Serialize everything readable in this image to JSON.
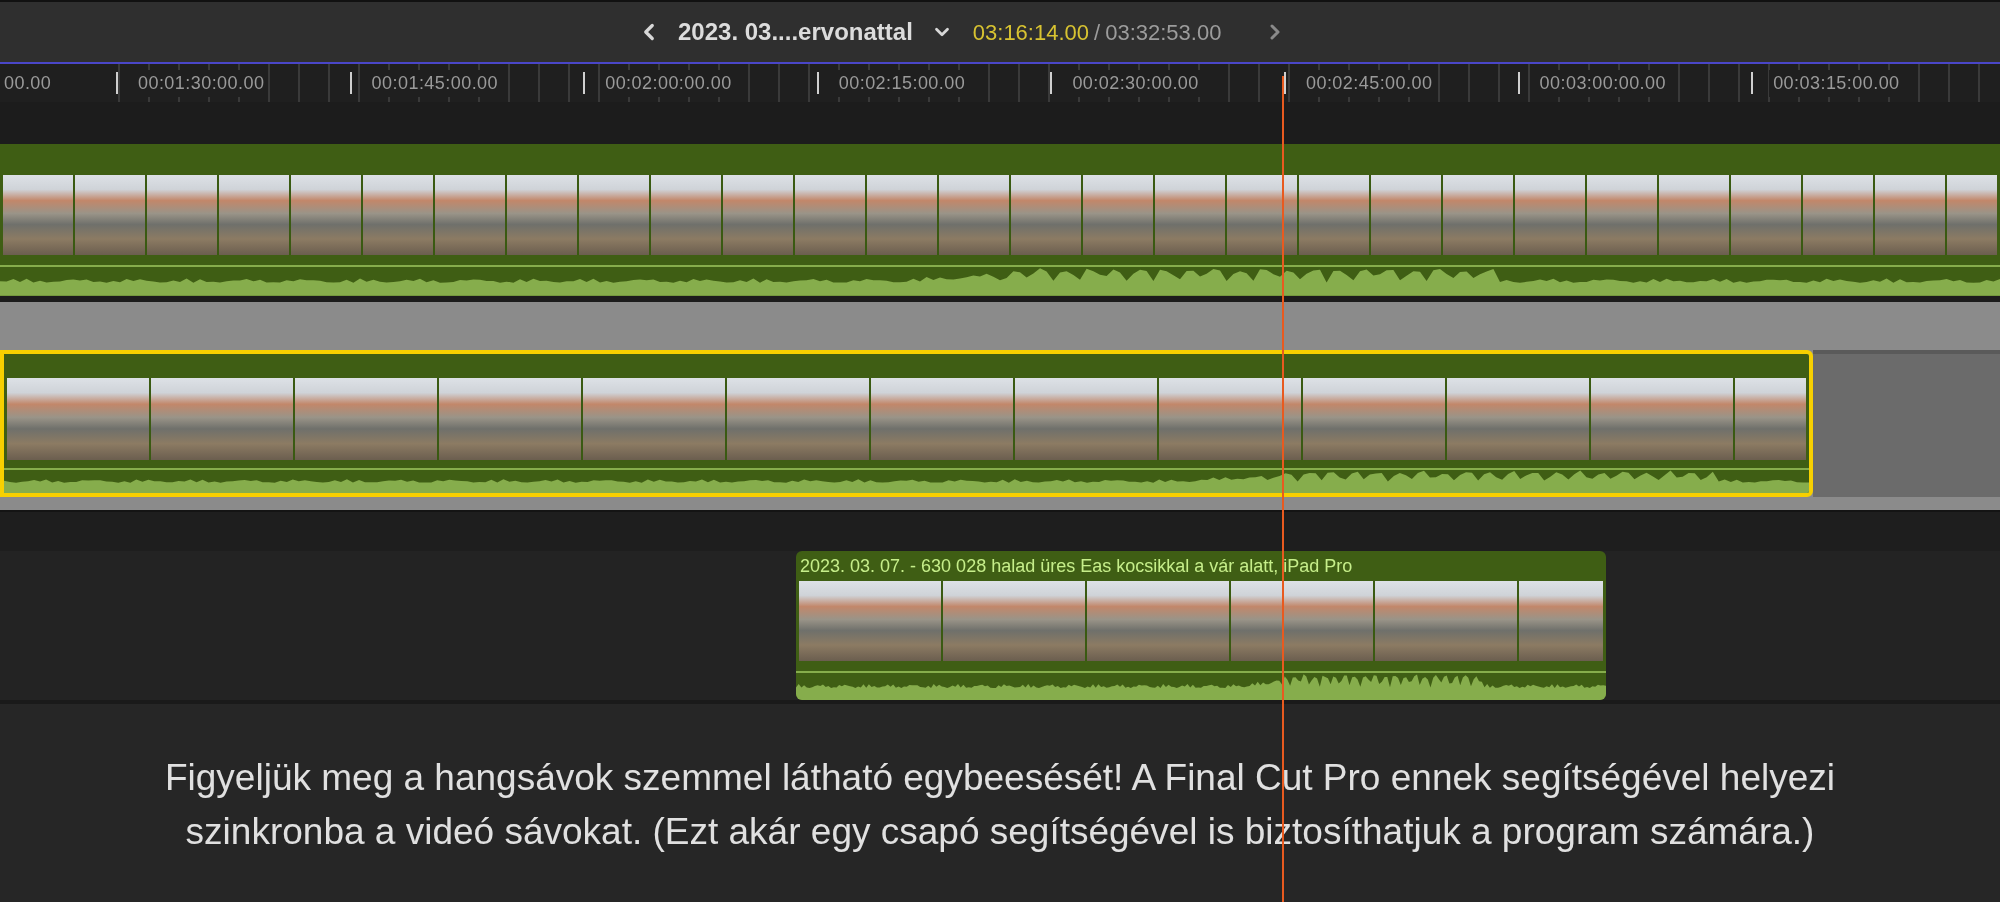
{
  "toolbar": {
    "title": "2023. 03....ervonattal",
    "current_time": "03:16:14.00",
    "separator": "/",
    "duration": "03:32:53.00"
  },
  "ruler": {
    "labels": [
      "00.00",
      "00:01:30:00.00",
      "00:01:45:00.00",
      "00:02:00:00.00",
      "00:02:15:00.00",
      "00:02:30:00.00",
      "00:02:45:00.00",
      "00:03:00:00.00",
      "00:03:15:00.00"
    ]
  },
  "clips": [
    {
      "selected": false
    },
    {
      "selected": true
    },
    {
      "selected": false,
      "title": "2023. 03. 07. - 630 028 halad üres Eas kocsikkal a vár alatt, iPad Pro"
    }
  ],
  "caption": "Figyeljük meg a hangsávok szemmel látható egybeesését! A Final Cut Pro ennek segítségével helyezi szinkronba a videó sávokat. (Ezt akár egy csapó segítségével is biztosíthatjuk a program számára.)"
}
